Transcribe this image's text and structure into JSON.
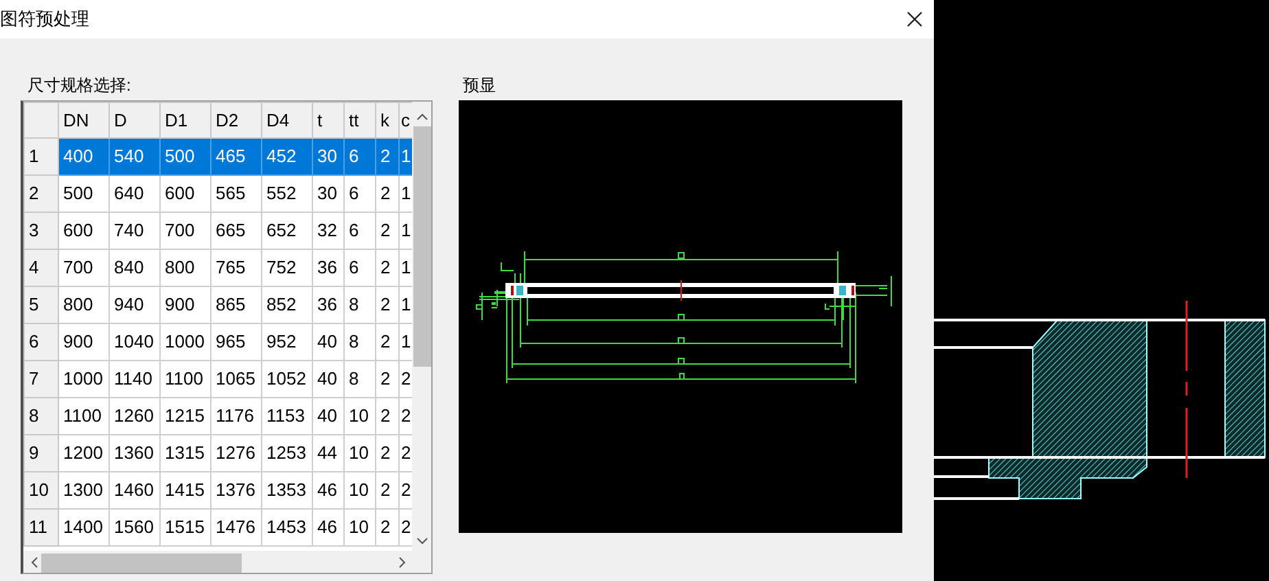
{
  "window": {
    "title": "图符预处理"
  },
  "spec_label": "尺寸规格选择:",
  "table": {
    "columns": [
      "DN",
      "D",
      "D1",
      "D2",
      "D4",
      "t",
      "tt",
      "k",
      "c"
    ],
    "rows": [
      {
        "header": "1",
        "selected": true,
        "cells": [
          "400",
          "540",
          "500",
          "465",
          "452",
          "30",
          "6",
          "2",
          "1"
        ]
      },
      {
        "header": "2",
        "selected": false,
        "cells": [
          "500",
          "640",
          "600",
          "565",
          "552",
          "30",
          "6",
          "2",
          "1"
        ]
      },
      {
        "header": "3",
        "selected": false,
        "cells": [
          "600",
          "740",
          "700",
          "665",
          "652",
          "32",
          "6",
          "2",
          "1"
        ]
      },
      {
        "header": "4",
        "selected": false,
        "cells": [
          "700",
          "840",
          "800",
          "765",
          "752",
          "36",
          "6",
          "2",
          "1"
        ]
      },
      {
        "header": "5",
        "selected": false,
        "cells": [
          "800",
          "940",
          "900",
          "865",
          "852",
          "36",
          "8",
          "2",
          "1"
        ]
      },
      {
        "header": "6",
        "selected": false,
        "cells": [
          "900",
          "1040",
          "1000",
          "965",
          "952",
          "40",
          "8",
          "2",
          "1"
        ]
      },
      {
        "header": "7",
        "selected": false,
        "cells": [
          "1000",
          "1140",
          "1100",
          "1065",
          "1052",
          "40",
          "8",
          "2",
          "2"
        ]
      },
      {
        "header": "8",
        "selected": false,
        "cells": [
          "1100",
          "1260",
          "1215",
          "1176",
          "1153",
          "40",
          "10",
          "2",
          "2"
        ]
      },
      {
        "header": "9",
        "selected": false,
        "cells": [
          "1200",
          "1360",
          "1315",
          "1276",
          "1253",
          "44",
          "10",
          "2",
          "2"
        ]
      },
      {
        "header": "10",
        "selected": false,
        "cells": [
          "1300",
          "1460",
          "1415",
          "1376",
          "1353",
          "46",
          "10",
          "2",
          "2"
        ]
      },
      {
        "header": "11",
        "selected": false,
        "cells": [
          "1400",
          "1560",
          "1515",
          "1476",
          "1453",
          "46",
          "10",
          "2",
          "2"
        ]
      }
    ]
  },
  "preview_label": "预显"
}
